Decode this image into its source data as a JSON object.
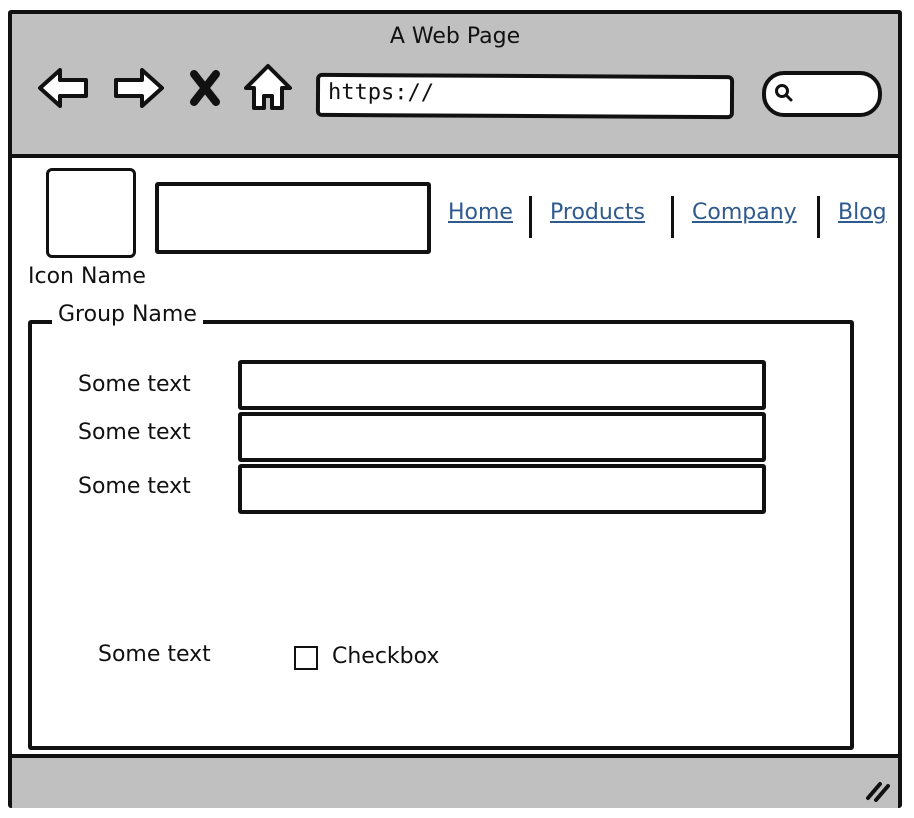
{
  "window": {
    "title": "A Web Page"
  },
  "toolbar": {
    "back_icon": "back-arrow-icon",
    "forward_icon": "forward-arrow-icon",
    "stop_icon": "close-icon",
    "home_icon": "home-icon",
    "url": "https://",
    "search_icon": "search-icon"
  },
  "header": {
    "logo_label": "Icon Name",
    "nav": [
      "Home",
      "Products",
      "Company",
      "Blog"
    ],
    "link_color": "#2e5a8e"
  },
  "group": {
    "legend": "Group Name",
    "fields": [
      "Some text",
      "Some text",
      "Some text"
    ],
    "bottom_label": "Some text",
    "checkbox_label": "Checkbox",
    "checkbox_checked": false
  },
  "colors": {
    "chrome": "#c0c0c0",
    "stroke": "#111111"
  },
  "statusbar": {
    "grip_icon": "resize-grip-icon"
  }
}
